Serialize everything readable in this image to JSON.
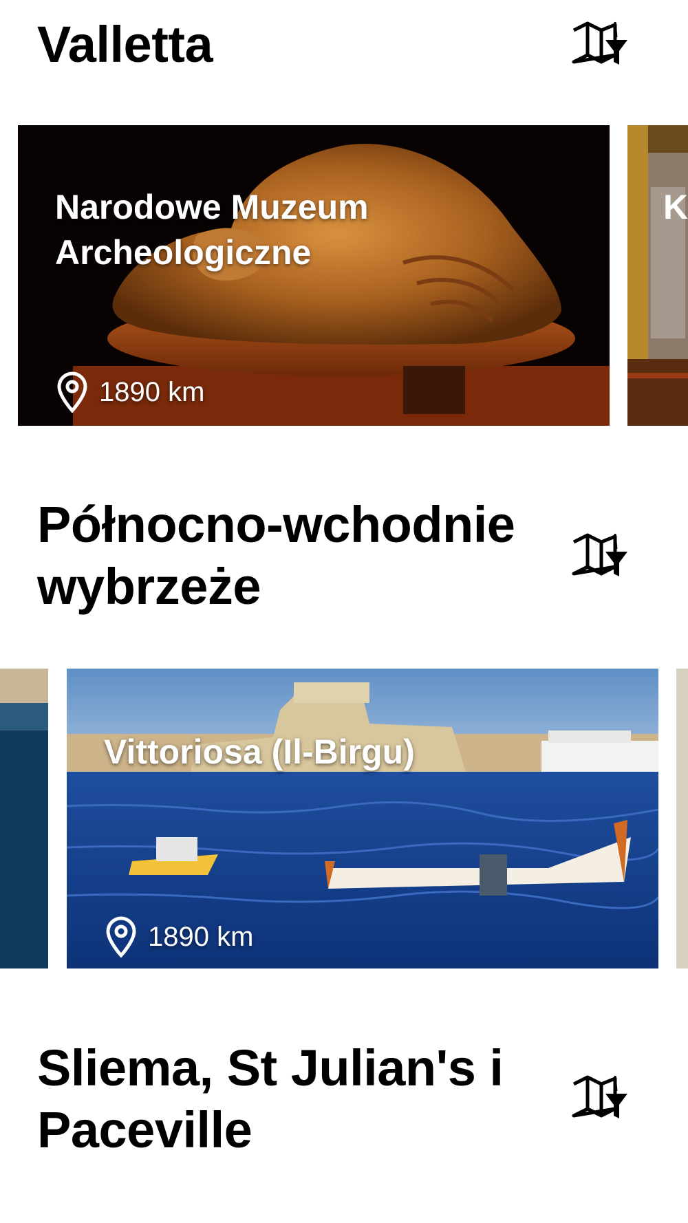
{
  "sections": [
    {
      "title": "Valletta",
      "map_icon": "map-filter-icon",
      "cards": [
        {
          "title_line1": "Narodowe Muzeum",
          "title_line2": "Archeologiczne",
          "distance": "1890 km",
          "image": "sleeping-lady-figurine",
          "pin_icon": "location-pin-icon"
        }
      ],
      "peek_next_letter": "K"
    },
    {
      "title_line1": "Północno-wchodnie",
      "title_line2": "wybrzeże",
      "map_icon": "map-filter-icon",
      "cards": [
        {
          "title": "Vittoriosa (Il-Birgu)",
          "distance": "1890 km",
          "image": "harbour-fort-boats",
          "pin_icon": "location-pin-icon"
        }
      ]
    },
    {
      "title_line1": "Sliema, St Julian's i",
      "title_line2": "Paceville",
      "map_icon": "map-filter-icon"
    }
  ],
  "colors": {
    "background": "#ffffff",
    "title": "#000000",
    "card_text": "#ffffff"
  }
}
